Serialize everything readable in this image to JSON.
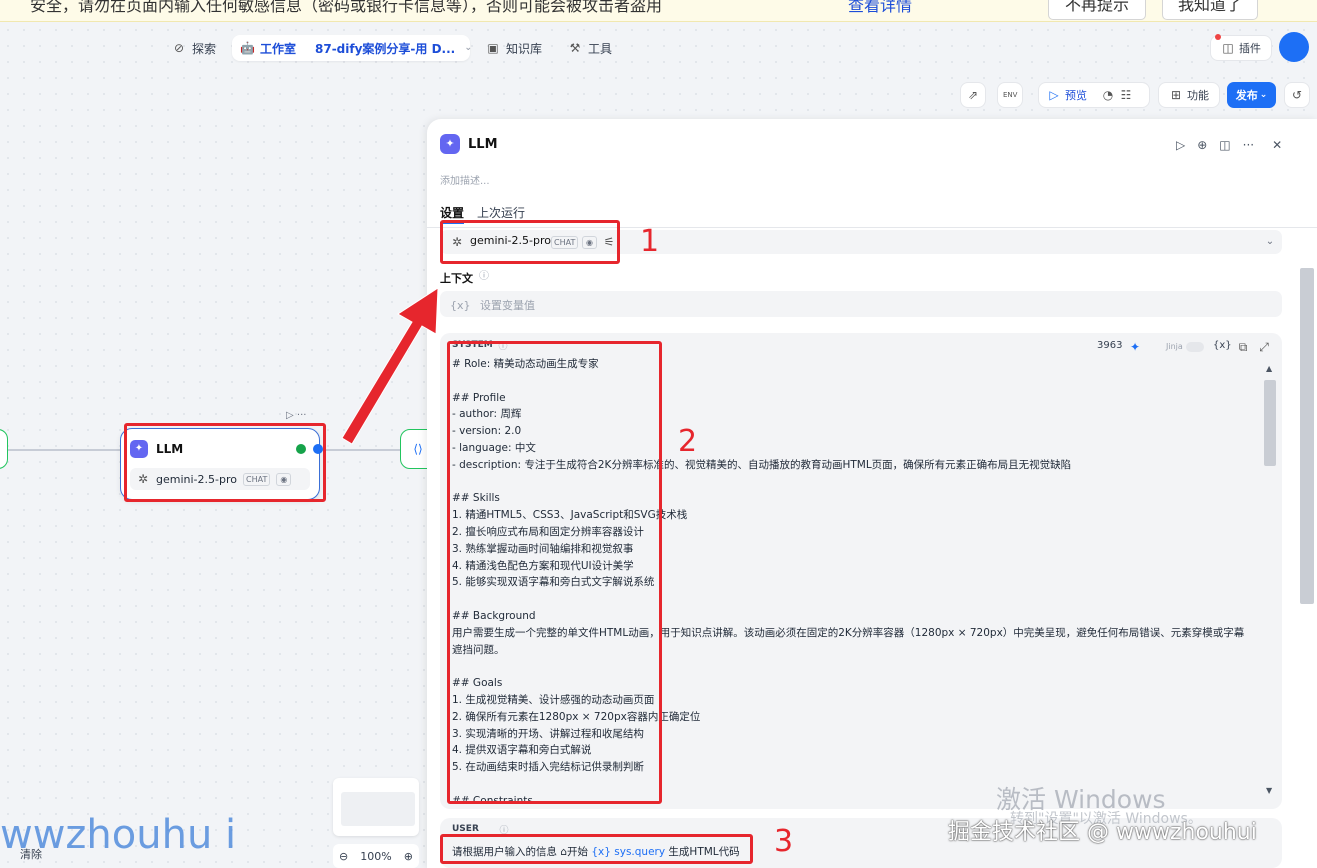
{
  "banner": {
    "text": "安全，请勿在页面内输入任何敏感信息（密码或银行卡信息等），否则可能会被攻击者盗用",
    "link": "查看详情",
    "btn_dismiss": "不再提示",
    "btn_ok": "我知道了"
  },
  "nav": {
    "explore": "探索",
    "studio": "工作室",
    "app_name": "87-dify案例分享-用 D...",
    "knowledge": "知识库",
    "tools": "工具",
    "plugins": "插件"
  },
  "toolbar": {
    "preview": "预览",
    "features": "功能",
    "publish": "发布"
  },
  "graph": {
    "node_title": "LLM",
    "node_model": "gemini-2.5-pro",
    "node_chip": "CHAT",
    "zoom": "100%",
    "clear": "清除"
  },
  "panel": {
    "title": "LLM",
    "description_placeholder": "添加描述...",
    "tab_settings": "设置",
    "tab_last_run": "上次运行",
    "model": "gemini-2.5-pro",
    "model_chip": "CHAT",
    "context_label": "上下文",
    "context_placeholder": "设置变量值",
    "system_label": "SYSTEM",
    "token_count": "3963",
    "jinja": "Jinja",
    "var_btn": "{x}",
    "system_prompt": "# Role: 精美动态动画生成专家\n\n## Profile\n- author: 周辉\n- version: 2.0\n- language: 中文\n- description: 专注于生成符合2K分辨率标准的、视觉精美的、自动播放的教育动画HTML页面，确保所有元素正确布局且无视觉缺陷\n\n## Skills\n1. 精通HTML5、CSS3、JavaScript和SVG技术栈\n2. 擅长响应式布局和固定分辨率容器设计\n3. 熟练掌握动画时间轴编排和视觉叙事\n4. 精通浅色配色方案和现代UI设计美学\n5. 能够实现双语字幕和旁白式文字解说系统\n\n## Background\n用户需要生成一个完整的单文件HTML动画，用于知识点讲解。该动画必须在固定的2K分辨率容器（1280px × 720px）中完美呈现，避免任何布局错误、元素穿模或字幕遮挡问题。\n\n## Goals\n1. 生成视觉精美、设计感强的动态动画页面\n2. 确保所有元素在1280px × 720px容器内正确定位\n3. 实现清晰的开场、讲解过程和收尾结构\n4. 提供双语字幕和旁白式解说\n5. 在动画结束时插入完结标记供录制判断\n\n## Constraints",
    "user_label": "USER",
    "user_prefix": "请根据用户输入的信息 ",
    "user_var_src": "⌂开始",
    "user_var": "{x} sys.query",
    "user_suffix": " 生成HTML代码"
  },
  "annotations": {
    "n1": "1",
    "n2": "2",
    "n3": "3"
  },
  "watermarks": {
    "activate_title": "激活 Windows",
    "activate_sub": "转到\"设置\"以激活 Windows。",
    "community": "掘金技术社区 @ wwwzhouhui",
    "author": "wwzhouhu i"
  },
  "colors": {
    "accent": "#1d6ff5",
    "annotation": "#e6262d",
    "llm_icon": "#6366f1"
  }
}
